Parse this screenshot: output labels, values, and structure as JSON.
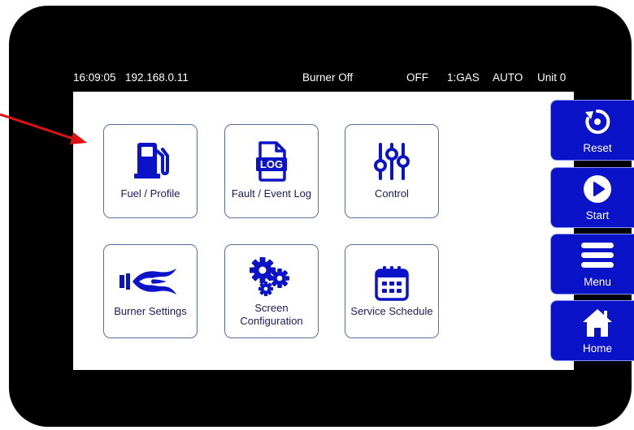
{
  "status": {
    "time": "16:09:05",
    "ip": "192.168.0.11",
    "burner_state": "Burner Off",
    "mode": "OFF",
    "fuel": "1:GAS",
    "control": "AUTO",
    "unit": "Unit 0"
  },
  "tiles": [
    {
      "label": "Fuel / Profile",
      "icon": "fuel-pump-icon"
    },
    {
      "label": "Fault / Event Log",
      "icon": "log-file-icon"
    },
    {
      "label": "Control",
      "icon": "sliders-icon"
    },
    {
      "label": "Burner Settings",
      "icon": "burner-flame-icon"
    },
    {
      "label_line1": "Screen",
      "label_line2": "Configuration",
      "icon": "gears-icon"
    },
    {
      "label": "Service Schedule",
      "icon": "calendar-icon"
    }
  ],
  "sidebar": {
    "reset": "Reset",
    "start": "Start",
    "menu": "Menu",
    "home": "Home"
  },
  "log_icon_text": "LOG",
  "colors": {
    "accent": "#0b13c8",
    "tile_text": "#1a1c5a",
    "tile_border": "#5a6f9e",
    "annotation_arrow": "#e01010"
  }
}
